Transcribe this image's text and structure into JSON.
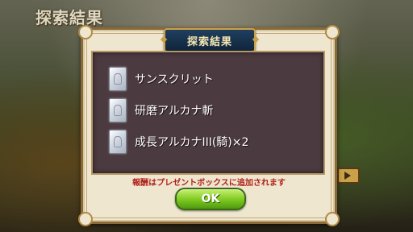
{
  "background": {
    "screen_title": "探索結果"
  },
  "dialog": {
    "title": "探索結果",
    "items": [
      {
        "label": "サンスクリット",
        "icon": "card-icon"
      },
      {
        "label": "研磨アルカナ斬",
        "icon": "card-icon"
      },
      {
        "label": "成長アルカナIII(騎)×2",
        "icon": "card-icon"
      }
    ],
    "notice": "報酬はプレゼントボックスに追加されます",
    "ok_label": "OK"
  },
  "colors": {
    "panel": "#4b3a40",
    "frame": "#efe6cf",
    "accent_gold": "#c8a14a",
    "notice_red": "#b0201a",
    "ok_green": "#7cc820"
  }
}
